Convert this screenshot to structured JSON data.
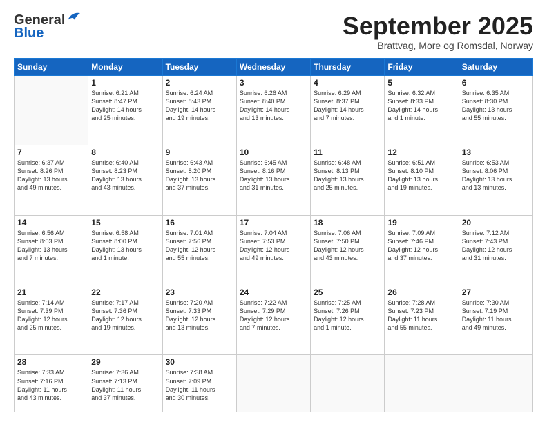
{
  "header": {
    "logo_line1": "General",
    "logo_line2": "Blue",
    "month": "September 2025",
    "location": "Brattvag, More og Romsdal, Norway"
  },
  "weekdays": [
    "Sunday",
    "Monday",
    "Tuesday",
    "Wednesday",
    "Thursday",
    "Friday",
    "Saturday"
  ],
  "weeks": [
    [
      {
        "day": "",
        "text": ""
      },
      {
        "day": "1",
        "text": "Sunrise: 6:21 AM\nSunset: 8:47 PM\nDaylight: 14 hours\nand 25 minutes."
      },
      {
        "day": "2",
        "text": "Sunrise: 6:24 AM\nSunset: 8:43 PM\nDaylight: 14 hours\nand 19 minutes."
      },
      {
        "day": "3",
        "text": "Sunrise: 6:26 AM\nSunset: 8:40 PM\nDaylight: 14 hours\nand 13 minutes."
      },
      {
        "day": "4",
        "text": "Sunrise: 6:29 AM\nSunset: 8:37 PM\nDaylight: 14 hours\nand 7 minutes."
      },
      {
        "day": "5",
        "text": "Sunrise: 6:32 AM\nSunset: 8:33 PM\nDaylight: 14 hours\nand 1 minute."
      },
      {
        "day": "6",
        "text": "Sunrise: 6:35 AM\nSunset: 8:30 PM\nDaylight: 13 hours\nand 55 minutes."
      }
    ],
    [
      {
        "day": "7",
        "text": "Sunrise: 6:37 AM\nSunset: 8:26 PM\nDaylight: 13 hours\nand 49 minutes."
      },
      {
        "day": "8",
        "text": "Sunrise: 6:40 AM\nSunset: 8:23 PM\nDaylight: 13 hours\nand 43 minutes."
      },
      {
        "day": "9",
        "text": "Sunrise: 6:43 AM\nSunset: 8:20 PM\nDaylight: 13 hours\nand 37 minutes."
      },
      {
        "day": "10",
        "text": "Sunrise: 6:45 AM\nSunset: 8:16 PM\nDaylight: 13 hours\nand 31 minutes."
      },
      {
        "day": "11",
        "text": "Sunrise: 6:48 AM\nSunset: 8:13 PM\nDaylight: 13 hours\nand 25 minutes."
      },
      {
        "day": "12",
        "text": "Sunrise: 6:51 AM\nSunset: 8:10 PM\nDaylight: 13 hours\nand 19 minutes."
      },
      {
        "day": "13",
        "text": "Sunrise: 6:53 AM\nSunset: 8:06 PM\nDaylight: 13 hours\nand 13 minutes."
      }
    ],
    [
      {
        "day": "14",
        "text": "Sunrise: 6:56 AM\nSunset: 8:03 PM\nDaylight: 13 hours\nand 7 minutes."
      },
      {
        "day": "15",
        "text": "Sunrise: 6:58 AM\nSunset: 8:00 PM\nDaylight: 13 hours\nand 1 minute."
      },
      {
        "day": "16",
        "text": "Sunrise: 7:01 AM\nSunset: 7:56 PM\nDaylight: 12 hours\nand 55 minutes."
      },
      {
        "day": "17",
        "text": "Sunrise: 7:04 AM\nSunset: 7:53 PM\nDaylight: 12 hours\nand 49 minutes."
      },
      {
        "day": "18",
        "text": "Sunrise: 7:06 AM\nSunset: 7:50 PM\nDaylight: 12 hours\nand 43 minutes."
      },
      {
        "day": "19",
        "text": "Sunrise: 7:09 AM\nSunset: 7:46 PM\nDaylight: 12 hours\nand 37 minutes."
      },
      {
        "day": "20",
        "text": "Sunrise: 7:12 AM\nSunset: 7:43 PM\nDaylight: 12 hours\nand 31 minutes."
      }
    ],
    [
      {
        "day": "21",
        "text": "Sunrise: 7:14 AM\nSunset: 7:39 PM\nDaylight: 12 hours\nand 25 minutes."
      },
      {
        "day": "22",
        "text": "Sunrise: 7:17 AM\nSunset: 7:36 PM\nDaylight: 12 hours\nand 19 minutes."
      },
      {
        "day": "23",
        "text": "Sunrise: 7:20 AM\nSunset: 7:33 PM\nDaylight: 12 hours\nand 13 minutes."
      },
      {
        "day": "24",
        "text": "Sunrise: 7:22 AM\nSunset: 7:29 PM\nDaylight: 12 hours\nand 7 minutes."
      },
      {
        "day": "25",
        "text": "Sunrise: 7:25 AM\nSunset: 7:26 PM\nDaylight: 12 hours\nand 1 minute."
      },
      {
        "day": "26",
        "text": "Sunrise: 7:28 AM\nSunset: 7:23 PM\nDaylight: 11 hours\nand 55 minutes."
      },
      {
        "day": "27",
        "text": "Sunrise: 7:30 AM\nSunset: 7:19 PM\nDaylight: 11 hours\nand 49 minutes."
      }
    ],
    [
      {
        "day": "28",
        "text": "Sunrise: 7:33 AM\nSunset: 7:16 PM\nDaylight: 11 hours\nand 43 minutes."
      },
      {
        "day": "29",
        "text": "Sunrise: 7:36 AM\nSunset: 7:13 PM\nDaylight: 11 hours\nand 37 minutes."
      },
      {
        "day": "30",
        "text": "Sunrise: 7:38 AM\nSunset: 7:09 PM\nDaylight: 11 hours\nand 30 minutes."
      },
      {
        "day": "",
        "text": ""
      },
      {
        "day": "",
        "text": ""
      },
      {
        "day": "",
        "text": ""
      },
      {
        "day": "",
        "text": ""
      }
    ]
  ]
}
